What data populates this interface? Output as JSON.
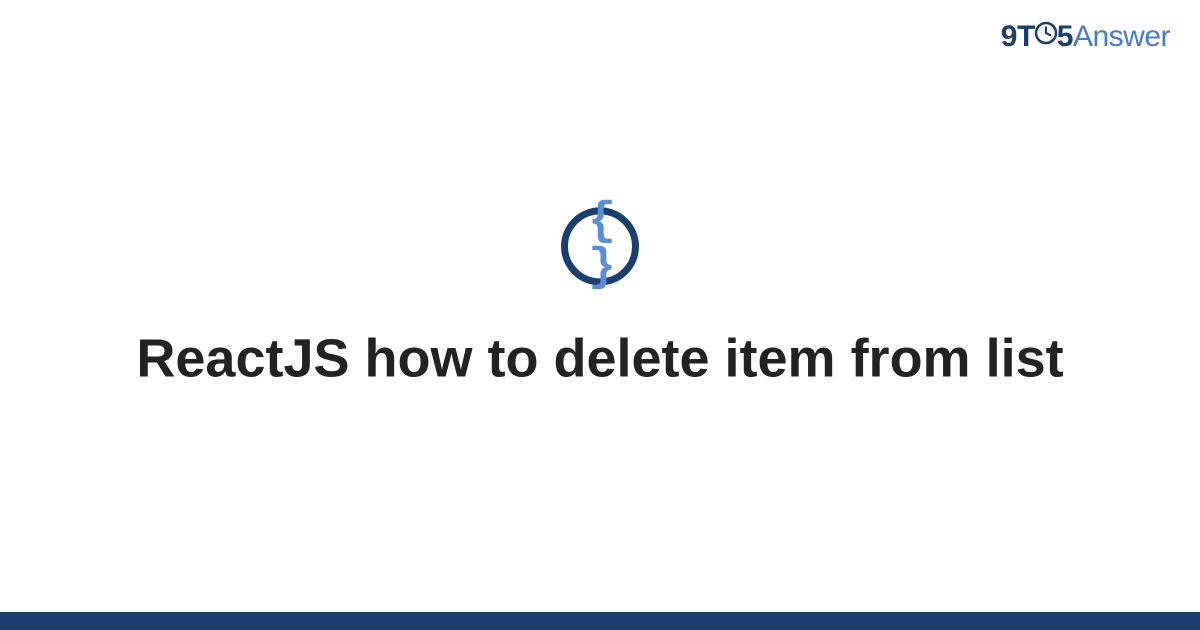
{
  "brand": {
    "part1": "9",
    "part2": "T",
    "part3": "5",
    "part4": "Answer"
  },
  "icon": {
    "glyph": "{ }",
    "name": "code-braces"
  },
  "title": "ReactJS how to delete item from list",
  "colors": {
    "brand_dark": "#1a3e6e",
    "brand_light": "#4a7bc4",
    "icon_fill": "#5b8dd6"
  }
}
